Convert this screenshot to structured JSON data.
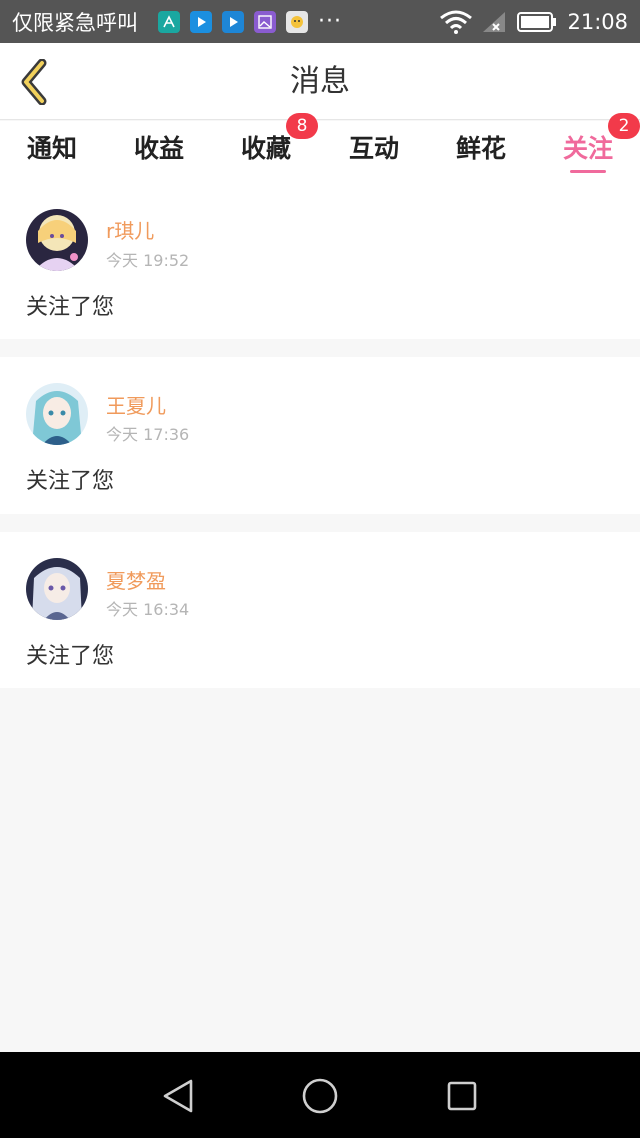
{
  "status_bar": {
    "carrier": "仅限紧急呼叫",
    "more": "···",
    "time": "21:08",
    "icons": [
      "app-notification-icon",
      "video-icon",
      "video-icon",
      "gallery-icon",
      "chat-icon",
      "wifi-icon",
      "signal-icon",
      "battery-icon"
    ]
  },
  "header": {
    "title": "消息",
    "back_icon": "chevron-left-icon",
    "accent_color": "#f06a9c"
  },
  "tabs": [
    {
      "label": "通知",
      "badge": "",
      "active": false
    },
    {
      "label": "收益",
      "badge": "",
      "active": false
    },
    {
      "label": "收藏",
      "badge": "8",
      "active": false
    },
    {
      "label": "互动",
      "badge": "",
      "active": false
    },
    {
      "label": "鲜花",
      "badge": "",
      "active": false
    },
    {
      "label": "关注",
      "badge": "2",
      "active": true
    }
  ],
  "messages": [
    {
      "name": "r琪儿",
      "time": "今天 19:52",
      "text": "关注了您"
    },
    {
      "name": "王夏儿",
      "time": "今天 17:36",
      "text": "关注了您"
    },
    {
      "name": "夏梦盈",
      "time": "今天 16:34",
      "text": "关注了您"
    }
  ],
  "nav_bar": {
    "back": "back-triangle-icon",
    "home": "home-circle-icon",
    "recents": "recents-square-icon"
  }
}
